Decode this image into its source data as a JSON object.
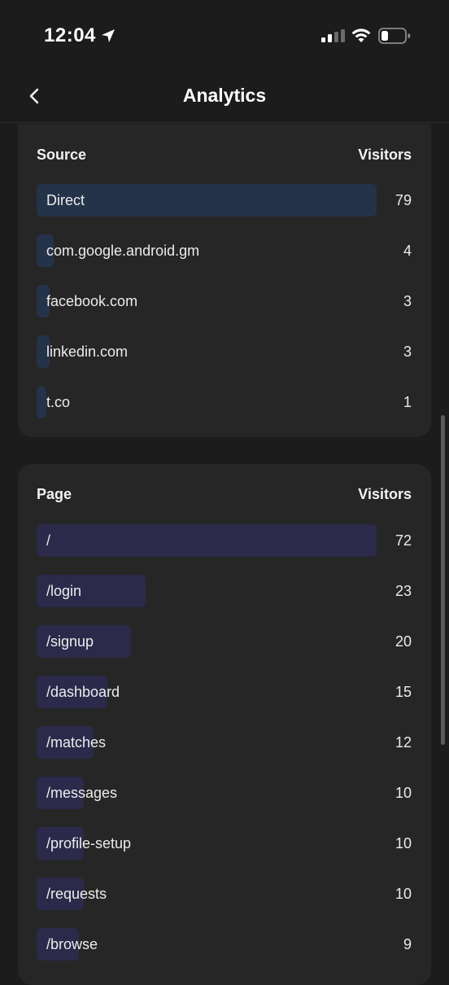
{
  "status_bar": {
    "time": "12:04",
    "icons": [
      "location-arrow-icon",
      "cellular-signal-icon",
      "wifi-icon",
      "battery-icon"
    ]
  },
  "nav": {
    "back_icon": "chevron-left-icon",
    "title": "Analytics"
  },
  "colors": {
    "background": "#1c1c1c",
    "card": "#262626",
    "source_bar": "#243349",
    "page_bar": "#2b2a4a",
    "text": "#f2f2f2"
  },
  "sources": {
    "header_label": "Source",
    "header_value": "Visitors",
    "rows": [
      {
        "label": "Direct",
        "value": "79"
      },
      {
        "label": "com.google.android.gm",
        "value": "4"
      },
      {
        "label": "facebook.com",
        "value": "3"
      },
      {
        "label": "linkedin.com",
        "value": "3"
      },
      {
        "label": "t.co",
        "value": "1"
      }
    ]
  },
  "pages": {
    "header_label": "Page",
    "header_value": "Visitors",
    "rows": [
      {
        "label": "/",
        "value": "72"
      },
      {
        "label": "/login",
        "value": "23"
      },
      {
        "label": "/signup",
        "value": "20"
      },
      {
        "label": "/dashboard",
        "value": "15"
      },
      {
        "label": "/matches",
        "value": "12"
      },
      {
        "label": "/messages",
        "value": "10"
      },
      {
        "label": "/profile-setup",
        "value": "10"
      },
      {
        "label": "/requests",
        "value": "10"
      },
      {
        "label": "/browse",
        "value": "9"
      }
    ]
  }
}
